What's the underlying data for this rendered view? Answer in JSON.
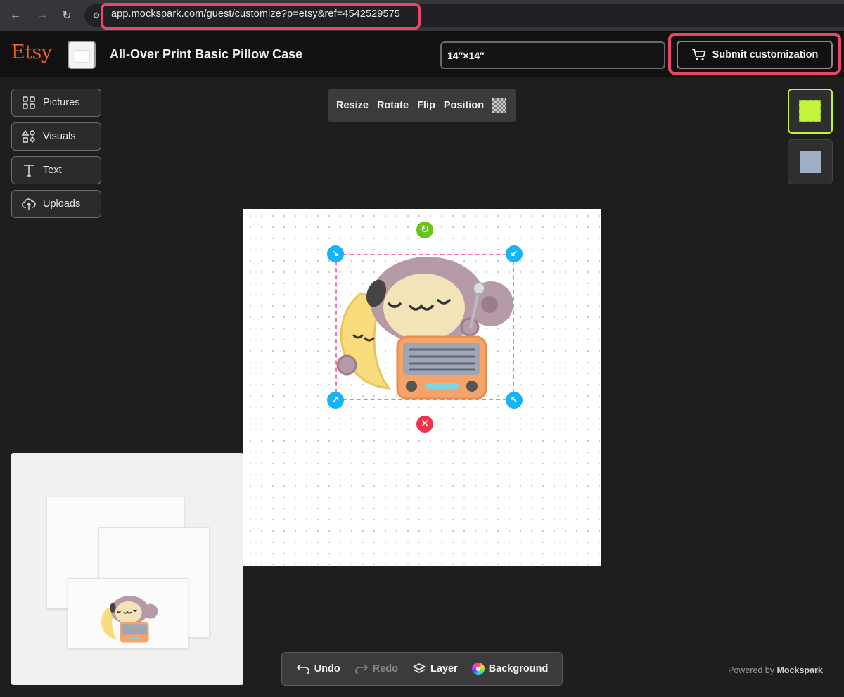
{
  "browser": {
    "url": "app.mockspark.com/guest/customize?p=etsy&ref=4542529575"
  },
  "header": {
    "brand": "Etsy",
    "product_title": "All-Over Print Basic Pillow Case",
    "size_value": "14″×14″",
    "submit_label": "Submit customization"
  },
  "tools": [
    {
      "label": "Pictures",
      "icon": "grid-icon"
    },
    {
      "label": "Visuals",
      "icon": "shapes-icon"
    },
    {
      "label": "Text",
      "icon": "text-icon"
    },
    {
      "label": "Uploads",
      "icon": "cloud-upload-icon"
    }
  ],
  "transform_toolbar": {
    "resize": "Resize",
    "rotate": "Rotate",
    "flip": "Flip",
    "position": "Position"
  },
  "swatches": [
    {
      "color": "#c3f53c",
      "selected": true
    },
    {
      "color": "#9daec6",
      "selected": false
    }
  ],
  "bottom_toolbar": {
    "undo": "Undo",
    "redo": "Redo",
    "layer": "Layer",
    "background": "Background"
  },
  "footer": {
    "powered_prefix": "Powered by",
    "powered_brand": "Mockspark"
  },
  "colors": {
    "accent_highlight": "#e8476a",
    "etsy_orange": "#f1641e",
    "handle_blue": "#14b4f5",
    "rotate_green": "#6ac21e",
    "delete_red": "#f2334e"
  }
}
